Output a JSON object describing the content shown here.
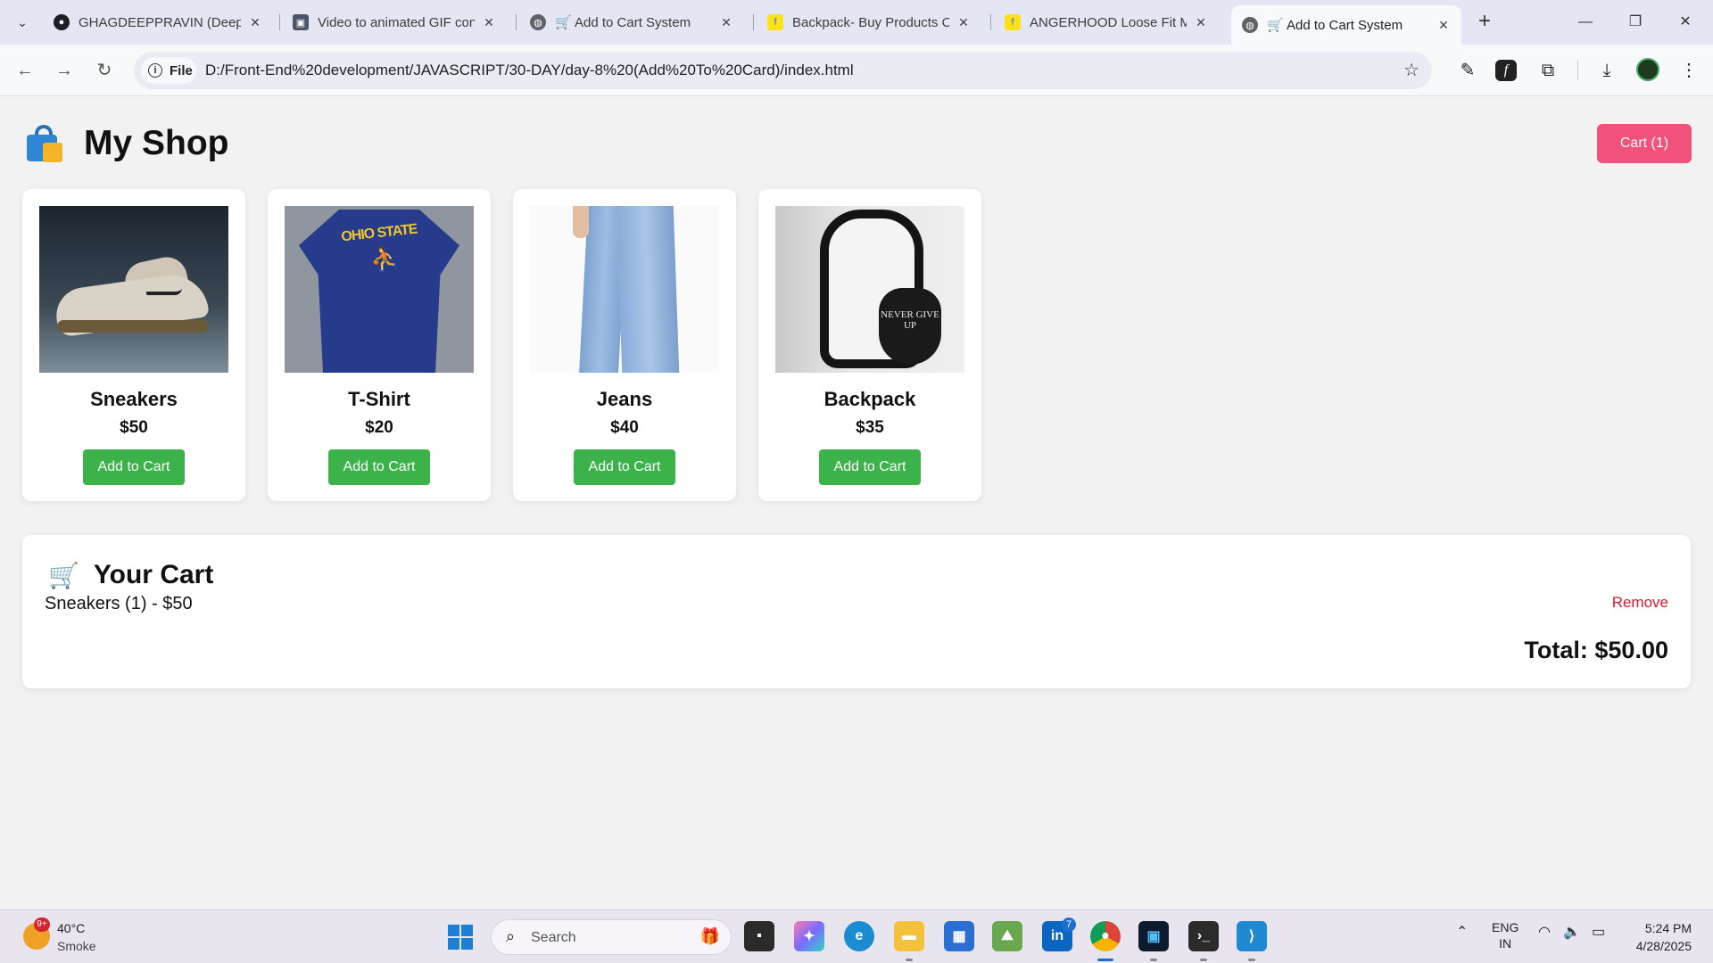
{
  "browser": {
    "tabs": [
      {
        "title": "GHAGDEEPPRAVIN (Deep",
        "icon": "github-icon"
      },
      {
        "title": "Video to animated GIF con",
        "icon": "ezgif-icon"
      },
      {
        "title": "🛒 Add to Cart System",
        "icon": "globe-icon"
      },
      {
        "title": "Backpack- Buy Products O",
        "icon": "flipkart-icon"
      },
      {
        "title": "ANGERHOOD Loose Fit M",
        "icon": "flipkart-icon"
      },
      {
        "title": "🛒 Add to Cart System",
        "icon": "globe-icon",
        "active": true
      }
    ],
    "address": {
      "scheme_label": "File",
      "url": "D:/Front-End%20development/JAVASCRIPT/30-DAY/day-8%20(Add%20To%20Card)/index.html"
    }
  },
  "shop": {
    "title": "My Shop",
    "cart_button": "Cart (1)",
    "products": [
      {
        "name": "Sneakers",
        "price": "$50",
        "button": "Add to Cart"
      },
      {
        "name": "T-Shirt",
        "price": "$20",
        "button": "Add to Cart"
      },
      {
        "name": "Jeans",
        "price": "$40",
        "button": "Add to Cart"
      },
      {
        "name": "Backpack",
        "price": "$35",
        "button": "Add to Cart"
      }
    ],
    "shirt_print": "OHIO STATE",
    "backpack_print": "NEVER GIVE UP"
  },
  "cart": {
    "title": "Your Cart",
    "items": [
      {
        "text": "Sneakers (1) - $50",
        "remove_label": "Remove"
      }
    ],
    "total": "Total: $50.00"
  },
  "taskbar": {
    "weather_badge": "9+",
    "temperature": "40°C",
    "condition": "Smoke",
    "search_placeholder": "Search",
    "linkedin_badge": "7",
    "language": "ENG",
    "region": "IN",
    "time": "5:24 PM",
    "date": "4/28/2025"
  },
  "colors": {
    "cart_button": "#f0527b",
    "add_button": "#3cb34a",
    "remove_text": "#d0192a"
  }
}
